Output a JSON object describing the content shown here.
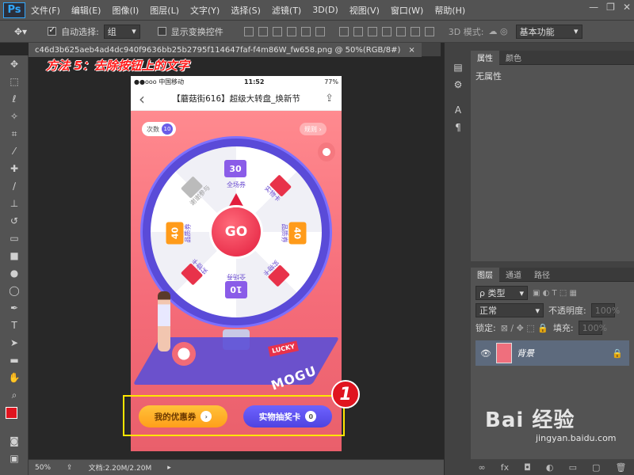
{
  "app": {
    "logo": "Ps"
  },
  "menu": [
    "文件(F)",
    "编辑(E)",
    "图像(I)",
    "图层(L)",
    "文字(Y)",
    "选择(S)",
    "滤镜(T)",
    "3D(D)",
    "视图(V)",
    "窗口(W)",
    "帮助(H)"
  ],
  "options": {
    "auto_select_label": "自动选择:",
    "auto_select_value": "组",
    "show_transform_label": "显示变换控件",
    "mode_3d_label": "3D 模式:",
    "workspace": "基本功能"
  },
  "document": {
    "tab_title": "c46d3b625aeb4ad4dc940f9636bb25b2795f114647faf-f4m86W_fw658.png @ 50%(RGB/8#)",
    "close": "×"
  },
  "annotation": {
    "title": "方法 5：去除按钮上的文字",
    "step": "1"
  },
  "phone": {
    "carrier": "●●ooo 中国移动",
    "time": "11:52",
    "battery": "77%",
    "nav_title": "【蘑菇街616】超级大转盘_焕新节",
    "back": "‹",
    "count_label": "次数",
    "count_value": "10",
    "rules": "规则 ›",
    "go": "GO",
    "prizes": {
      "top": "全场券",
      "top_value": "30",
      "top_right": "实物卡",
      "right": "品质券",
      "right_value": "40",
      "bottom_right": "实物卡",
      "bottom": "全场券",
      "bottom_value": "10",
      "bottom_left": "实物卡",
      "left": "品质券",
      "left_value": "40",
      "top_left": "谢谢参与"
    },
    "lucky": "LUCKY",
    "mogu": "MOGU",
    "btn_coupon": "我的优惠券",
    "btn_coupon_icon": "›",
    "btn_lottery": "实物抽奖卡",
    "btn_lottery_count": "0"
  },
  "right_panel": {
    "tabs_top": [
      "属性",
      "颜色"
    ],
    "properties_empty": "无属性",
    "tabs_layers": [
      "图层",
      "通道",
      "路径"
    ],
    "kind_filter": "ρ 类型",
    "blend_mode": "正常",
    "opacity_label": "不透明度:",
    "opacity_value": "100%",
    "lock_label": "锁定:",
    "fill_label": "填充:",
    "fill_value": "100%",
    "layer_name": "背景"
  },
  "status": {
    "zoom": "50%",
    "doc_size": "文档:2.20M/2.20M"
  },
  "watermark": {
    "logo": "Bai 经验",
    "url": "jingyan.baidu.com"
  },
  "colors": {
    "ps_blue": "#31a8ff",
    "annotation_red": "#ff1a1a",
    "highlight": "#ffe600",
    "layer_selected": "#5d6a7d"
  }
}
